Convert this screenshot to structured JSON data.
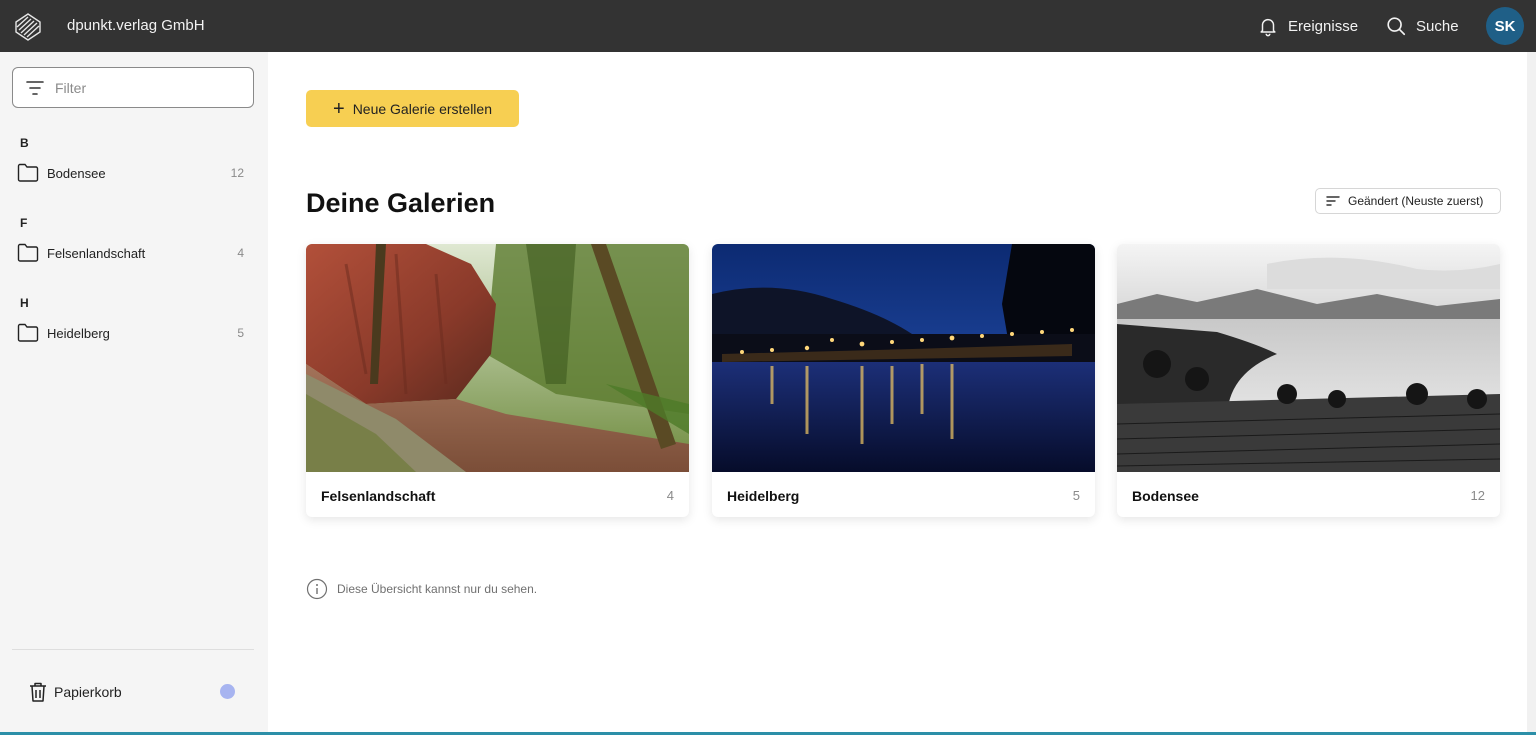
{
  "header": {
    "company": "dpunkt.verlag GmbH",
    "events_label": "Ereignisse",
    "search_label": "Suche",
    "avatar_initials": "SK",
    "bar_color": "#333333",
    "avatar_color": "#1f5f87"
  },
  "sidebar": {
    "filter_placeholder": "Filter",
    "groups": [
      {
        "letter": "B",
        "items": [
          {
            "label": "Bodensee",
            "count": "12"
          }
        ]
      },
      {
        "letter": "F",
        "items": [
          {
            "label": "Felsenlandschaft",
            "count": "4"
          }
        ]
      },
      {
        "letter": "H",
        "items": [
          {
            "label": "Heidelberg",
            "count": "5"
          }
        ]
      }
    ],
    "trash_label": "Papierkorb",
    "icons": {
      "filter": "filter-lines-icon",
      "folder": "folder-icon",
      "trash": "trash-icon"
    }
  },
  "main": {
    "new_gallery_label": "Neue Galerie erstellen",
    "new_gallery_color": "#f7cf52",
    "title": "Deine Galerien",
    "sort_label": "Geändert (Neuste zuerst)",
    "galleries": [
      {
        "title": "Felsenlandschaft",
        "count": "4",
        "image": "red sandstone cliff with forest path"
      },
      {
        "title": "Heidelberg",
        "count": "5",
        "image": "night view of old bridge and river with reflections"
      },
      {
        "title": "Bodensee",
        "count": "12",
        "image": "black and white lake landscape with mountains"
      }
    ],
    "info_text": "Diese Übersicht kannst nur du sehen."
  }
}
